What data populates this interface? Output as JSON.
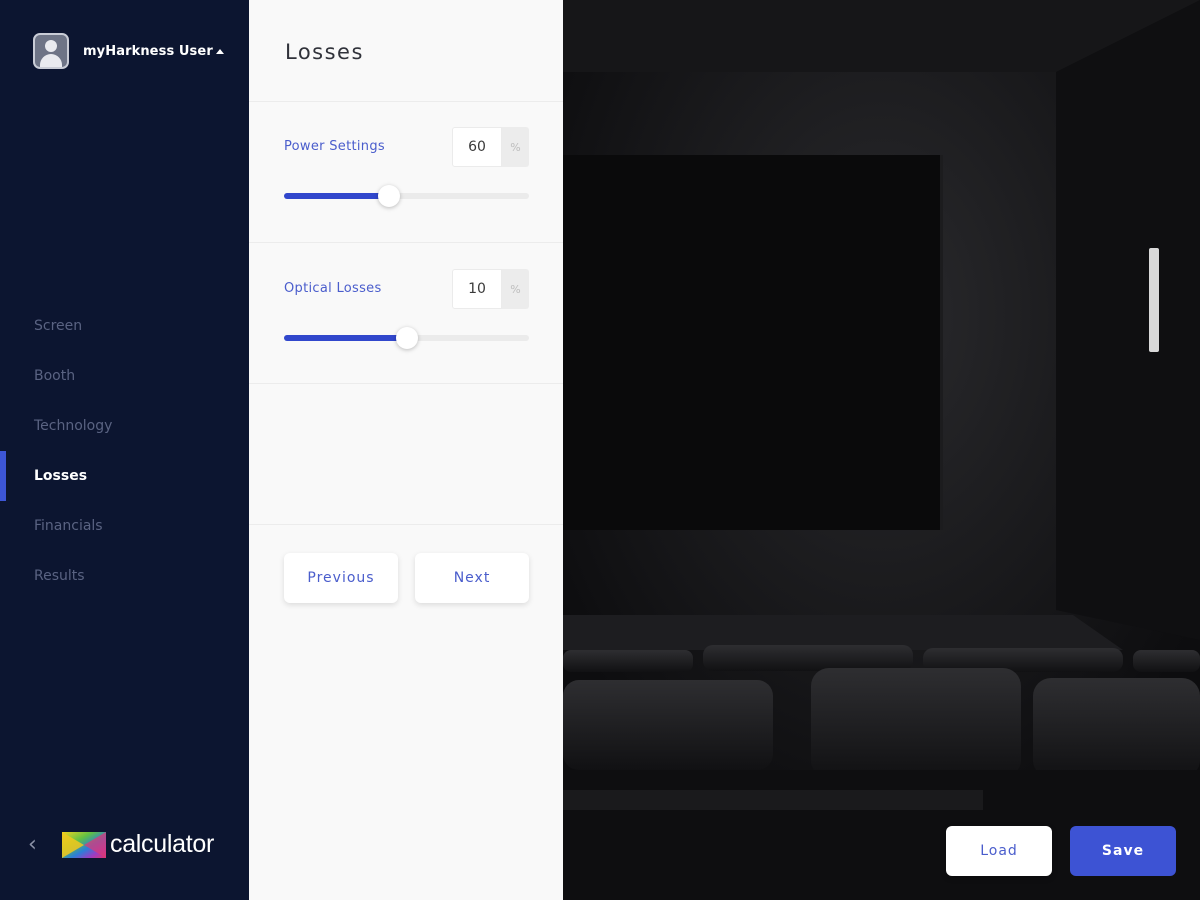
{
  "user": {
    "name": "myHarkness User"
  },
  "nav": {
    "items": [
      {
        "label": "Screen",
        "active": false
      },
      {
        "label": "Booth",
        "active": false
      },
      {
        "label": "Technology",
        "active": false
      },
      {
        "label": "Losses",
        "active": true
      },
      {
        "label": "Financials",
        "active": false
      },
      {
        "label": "Results",
        "active": false
      }
    ]
  },
  "footer": {
    "brand": "calculator"
  },
  "panel": {
    "title": "Losses",
    "settings": [
      {
        "label": "Power Settings",
        "value": "60",
        "unit": "%",
        "slider_percent": 43
      },
      {
        "label": "Optical Losses",
        "value": "10",
        "unit": "%",
        "slider_percent": 50
      }
    ],
    "previous_label": "Previous",
    "next_label": "Next"
  },
  "actions": {
    "load_label": "Load",
    "save_label": "Save"
  },
  "colors": {
    "sidebar": "#0c1530",
    "accent": "#3d53d4",
    "panel": "#f9f9f9"
  }
}
